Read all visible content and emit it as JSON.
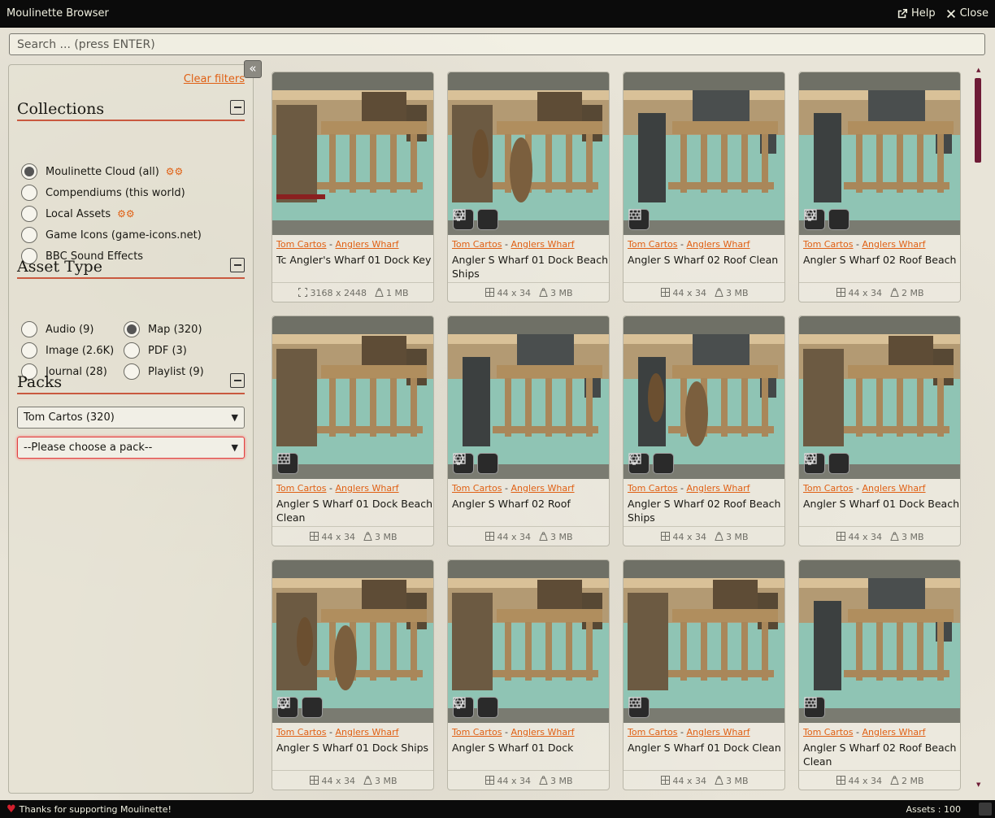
{
  "window": {
    "title": "Moulinette Browser",
    "help_label": "Help",
    "close_label": "Close"
  },
  "search": {
    "placeholder": "Search ... (press ENTER)"
  },
  "sidebar": {
    "clear_filters": "Clear filters",
    "collapse_glyph": "«",
    "collections": {
      "title": "Collections",
      "items": [
        {
          "label": "Moulinette Cloud (all)",
          "checked": true,
          "has_settings": true
        },
        {
          "label": "Compendiums (this world)",
          "checked": false,
          "has_settings": false
        },
        {
          "label": "Local Assets",
          "checked": false,
          "has_settings": true
        },
        {
          "label": "Game Icons (game-icons.net)",
          "checked": false,
          "has_settings": false
        },
        {
          "label": "BBC Sound Effects",
          "checked": false,
          "has_settings": false
        }
      ]
    },
    "asset_type": {
      "title": "Asset Type",
      "items": [
        {
          "label": "Audio (9)",
          "checked": false
        },
        {
          "label": "Map (320)",
          "checked": true
        },
        {
          "label": "Image (2.6K)",
          "checked": false
        },
        {
          "label": "PDF (3)",
          "checked": false
        },
        {
          "label": "Journal (28)",
          "checked": false
        },
        {
          "label": "Playlist (9)",
          "checked": false
        }
      ]
    },
    "packs": {
      "title": "Packs",
      "creator_select": "Tom Cartos (320)",
      "pack_select": "--Please choose a pack--"
    }
  },
  "cards": [
    {
      "creator": "Tom Cartos",
      "pack": "Anglers Wharf",
      "title": "Tc Angler's Wharf 01 Dock Key",
      "dims": "3168 x 2448",
      "size": "1 MB",
      "dims_kind": "pixels",
      "badges": [],
      "variant": "dock-key"
    },
    {
      "creator": "Tom Cartos",
      "pack": "Anglers Wharf",
      "title": "Angler S Wharf 01 Dock Beach Ships",
      "dims": "44 x 34",
      "size": "3 MB",
      "dims_kind": "grid",
      "badges": [
        "wall-icon",
        "light-icon"
      ],
      "variant": "dock-ships"
    },
    {
      "creator": "Tom Cartos",
      "pack": "Anglers Wharf",
      "title": "Angler S Wharf 02 Roof Clean",
      "dims": "44 x 34",
      "size": "3 MB",
      "dims_kind": "grid",
      "badges": [
        "wall-icon"
      ],
      "variant": "roof"
    },
    {
      "creator": "Tom Cartos",
      "pack": "Anglers Wharf",
      "title": "Angler S Wharf 02 Roof Beach",
      "dims": "44 x 34",
      "size": "2 MB",
      "dims_kind": "grid",
      "badges": [
        "wall-icon",
        "light-icon"
      ],
      "variant": "roof"
    },
    {
      "creator": "Tom Cartos",
      "pack": "Anglers Wharf",
      "title": "Angler S Wharf 01 Dock Beach Clean",
      "dims": "44 x 34",
      "size": "3 MB",
      "dims_kind": "grid",
      "badges": [
        "wall-icon"
      ],
      "variant": "dock"
    },
    {
      "creator": "Tom Cartos",
      "pack": "Anglers Wharf",
      "title": "Angler S Wharf 02 Roof",
      "dims": "44 x 34",
      "size": "3 MB",
      "dims_kind": "grid",
      "badges": [
        "wall-icon",
        "light-icon"
      ],
      "variant": "roof"
    },
    {
      "creator": "Tom Cartos",
      "pack": "Anglers Wharf",
      "title": "Angler S Wharf 02 Roof Beach Ships",
      "dims": "44 x 34",
      "size": "3 MB",
      "dims_kind": "grid",
      "badges": [
        "wall-icon",
        "light-icon"
      ],
      "variant": "roof-ships"
    },
    {
      "creator": "Tom Cartos",
      "pack": "Anglers Wharf",
      "title": "Angler S Wharf 01 Dock Beach",
      "dims": "44 x 34",
      "size": "3 MB",
      "dims_kind": "grid",
      "badges": [
        "wall-icon",
        "light-icon"
      ],
      "variant": "dock"
    },
    {
      "creator": "Tom Cartos",
      "pack": "Anglers Wharf",
      "title": "Angler S Wharf 01 Dock Ships",
      "dims": "44 x 34",
      "size": "3 MB",
      "dims_kind": "grid",
      "badges": [
        "wall-icon",
        "light-icon"
      ],
      "variant": "dock-ships"
    },
    {
      "creator": "Tom Cartos",
      "pack": "Anglers Wharf",
      "title": "Angler S Wharf 01 Dock",
      "dims": "44 x 34",
      "size": "3 MB",
      "dims_kind": "grid",
      "badges": [
        "wall-icon",
        "light-icon"
      ],
      "variant": "dock"
    },
    {
      "creator": "Tom Cartos",
      "pack": "Anglers Wharf",
      "title": "Angler S Wharf 01 Dock Clean",
      "dims": "44 x 34",
      "size": "3 MB",
      "dims_kind": "grid",
      "badges": [
        "wall-icon"
      ],
      "variant": "dock"
    },
    {
      "creator": "Tom Cartos",
      "pack": "Anglers Wharf",
      "title": "Angler S Wharf 02 Roof Beach Clean",
      "dims": "44 x 34",
      "size": "2 MB",
      "dims_kind": "grid",
      "badges": [
        "wall-icon"
      ],
      "variant": "roof"
    }
  ],
  "footer": {
    "thanks": "Thanks for supporting Moulinette!",
    "assets_count": "Assets : 100"
  },
  "colors": {
    "accent": "#e06014",
    "scrollbar": "#6e1b36",
    "section_rule": "#c9593f",
    "water": "#8fc4b4"
  }
}
